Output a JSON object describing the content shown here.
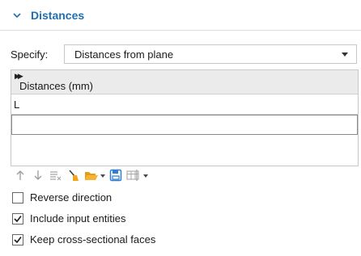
{
  "section": {
    "title": "Distances"
  },
  "specify": {
    "label": "Specify:",
    "value": "Distances from plane"
  },
  "table": {
    "column_header": "Distances (mm)",
    "rows": [
      "L",
      "",
      ""
    ]
  },
  "toolbar": {
    "icons": [
      "arrow-up-icon",
      "arrow-down-icon",
      "delete-list-icon",
      "clear-brush-icon",
      "open-folder-icon",
      "save-icon",
      "load-table-icon"
    ]
  },
  "options": {
    "reverse_direction": {
      "label": "Reverse direction",
      "checked": false
    },
    "include_input_entities": {
      "label": "Include input entities",
      "checked": true
    },
    "keep_cross_sectional_faces": {
      "label": "Keep cross-sectional faces",
      "checked": true
    }
  },
  "colors": {
    "accent": "#1f6fb2",
    "folder": "#f2a51a",
    "save": "#2f7fd1"
  }
}
